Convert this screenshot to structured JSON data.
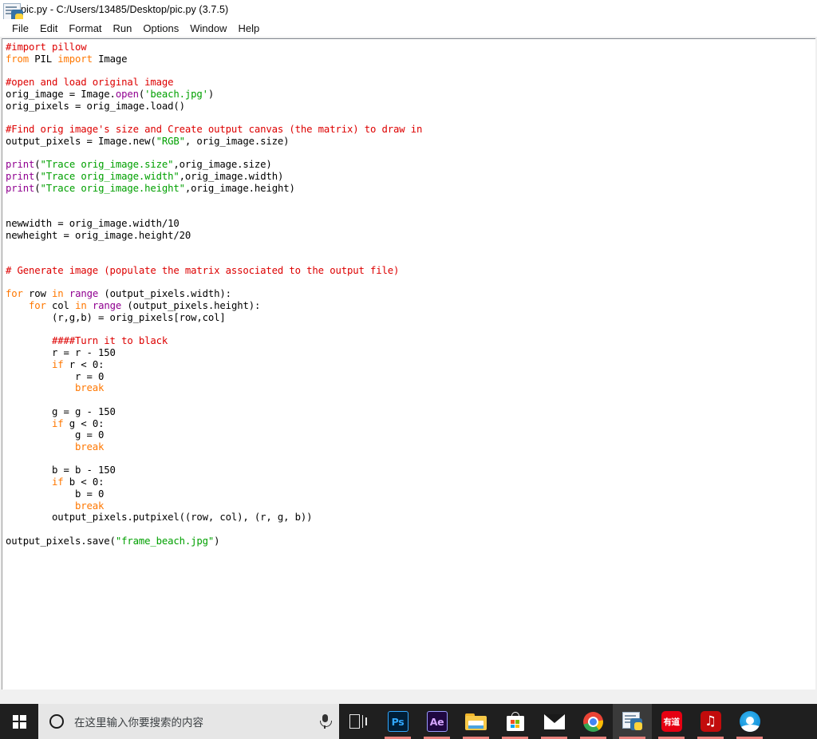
{
  "window": {
    "title": "pic.py - C:/Users/13485/Desktop/pic.py (3.7.5)",
    "icon": "python-idle-icon"
  },
  "menu": {
    "items": [
      {
        "label": "File",
        "name": "menu-file"
      },
      {
        "label": "Edit",
        "name": "menu-edit"
      },
      {
        "label": "Format",
        "name": "menu-format"
      },
      {
        "label": "Run",
        "name": "menu-run"
      },
      {
        "label": "Options",
        "name": "menu-options"
      },
      {
        "label": "Window",
        "name": "menu-window"
      },
      {
        "label": "Help",
        "name": "menu-help"
      }
    ]
  },
  "editor": {
    "language": "python",
    "colors": {
      "comment": "#dd0000",
      "keyword": "#ff7700",
      "string": "#00a000",
      "builtin": "#900090",
      "normal": "#000000",
      "background": "#ffffff"
    },
    "lines": [
      "#import pillow",
      "from PIL import Image",
      "",
      "#open and load original image",
      "orig_image = Image.open('beach.jpg')",
      "orig_pixels = orig_image.load()",
      "",
      "#Find orig image's size and Create output canvas (the matrix) to draw in",
      "output_pixels = Image.new(\"RGB\", orig_image.size)",
      "",
      "print(\"Trace orig_image.size\",orig_image.size)",
      "print(\"Trace orig_image.width\",orig_image.width)",
      "print(\"Trace orig_image.height\",orig_image.height)",
      "",
      "",
      "newwidth = orig_image.width/10",
      "newheight = orig_image.height/20",
      "",
      "",
      "# Generate image (populate the matrix associated to the output file)",
      "",
      "for row in range (output_pixels.width):",
      "    for col in range (output_pixels.height):",
      "        (r,g,b) = orig_pixels[row,col]",
      "",
      "        ####Turn it to black",
      "        r = r - 150",
      "        if r < 0:",
      "            r = 0",
      "            break",
      "",
      "        g = g - 150",
      "        if g < 0:",
      "            g = 0",
      "            break",
      "",
      "        b = b - 150",
      "        if b < 0:",
      "            b = 0",
      "            break",
      "        output_pixels.putpixel((row, col), (r, g, b))",
      "",
      "output_pixels.save(\"frame_beach.jpg\")"
    ]
  },
  "taskbar": {
    "background": "#1f1f1f",
    "start": {
      "name": "start-button",
      "label": "Start"
    },
    "search": {
      "placeholder": "在这里输入你要搜索的内容",
      "background": "#e6e6e6",
      "cortana_icon": "cortana-circle-icon",
      "mic_icon": "microphone-icon"
    },
    "items": [
      {
        "name": "taskbar-task-view",
        "label": "Task View",
        "icon": "task-view-icon",
        "active": false,
        "running": false
      },
      {
        "name": "taskbar-photoshop",
        "label": "Adobe Photoshop",
        "icon": "photoshop-icon",
        "active": false,
        "running": true,
        "badge": "Ps"
      },
      {
        "name": "taskbar-after-effects",
        "label": "Adobe After Effects",
        "icon": "after-effects-icon",
        "active": false,
        "running": true,
        "badge": "Ae"
      },
      {
        "name": "taskbar-file-explorer",
        "label": "File Explorer",
        "icon": "folder-icon",
        "active": false,
        "running": true
      },
      {
        "name": "taskbar-microsoft-store",
        "label": "Microsoft Store",
        "icon": "store-bag-icon",
        "active": false,
        "running": true
      },
      {
        "name": "taskbar-mail",
        "label": "Mail",
        "icon": "mail-envelope-icon",
        "active": false,
        "running": true
      },
      {
        "name": "taskbar-chrome",
        "label": "Google Chrome",
        "icon": "chrome-icon",
        "active": false,
        "running": true
      },
      {
        "name": "taskbar-python-idle",
        "label": "Python IDLE",
        "icon": "python-idle-icon",
        "active": true,
        "running": true
      },
      {
        "name": "taskbar-youdao",
        "label": "有道",
        "icon": "youdao-icon",
        "active": false,
        "running": true,
        "badge": "有道"
      },
      {
        "name": "taskbar-netease-music",
        "label": "网易云音乐",
        "icon": "netease-music-icon",
        "active": false,
        "running": true
      },
      {
        "name": "taskbar-qq-browser",
        "label": "QQ Browser",
        "icon": "qq-browser-icon",
        "active": false,
        "running": true
      }
    ]
  }
}
